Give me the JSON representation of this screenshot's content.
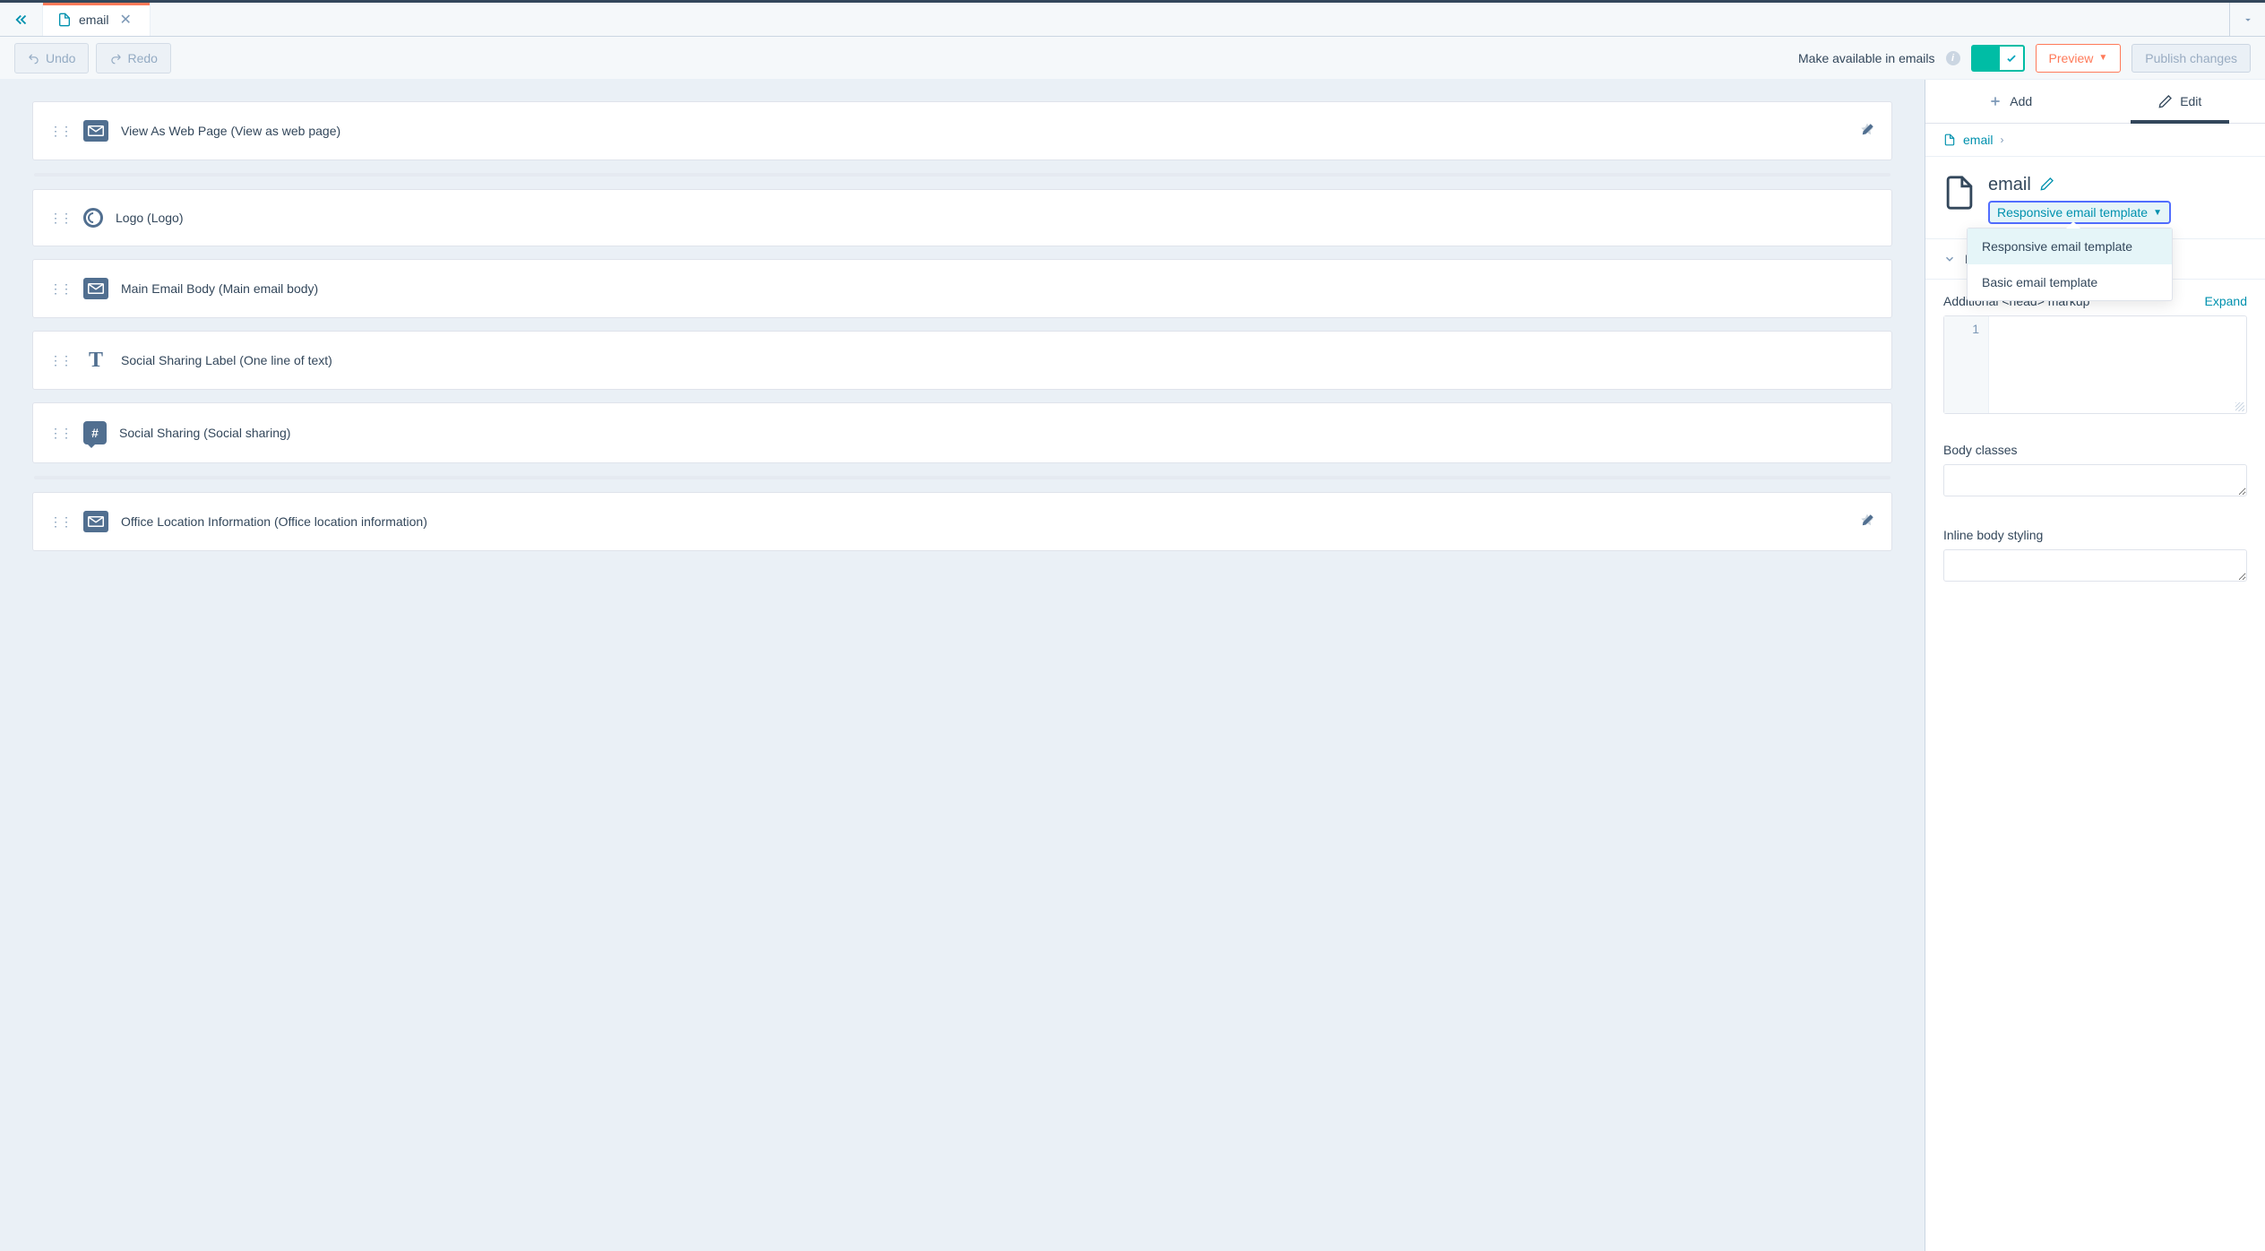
{
  "tabbar": {
    "tab_label": "email"
  },
  "toolbar": {
    "undo": "Undo",
    "redo": "Redo",
    "available_label": "Make available in emails",
    "preview": "Preview",
    "publish": "Publish changes"
  },
  "modules": [
    {
      "icon": "envelope",
      "label": "View As Web Page (View as web page)",
      "action": true
    },
    {
      "separator": true
    },
    {
      "icon": "logo",
      "label": "Logo (Logo)"
    },
    {
      "icon": "envelope",
      "label": "Main Email Body (Main email body)"
    },
    {
      "icon": "text",
      "label": "Social Sharing Label (One line of text)"
    },
    {
      "icon": "hash",
      "label": "Social Sharing (Social sharing)"
    },
    {
      "separator": true
    },
    {
      "icon": "envelope",
      "label": "Office Location Information (Office location information)",
      "action": true
    }
  ],
  "sidebar": {
    "tabs": {
      "add": "Add",
      "edit": "Edit"
    },
    "breadcrumb": "email",
    "title": "email",
    "template_selected": "Responsive email template",
    "template_options": [
      "Responsive email template",
      "Basic email template"
    ],
    "section_head": "Head and body options",
    "fields": {
      "head_markup_label": "Additional <head> markup",
      "expand": "Expand",
      "code_line": "1",
      "body_classes_label": "Body classes",
      "inline_body_label": "Inline body styling"
    }
  }
}
